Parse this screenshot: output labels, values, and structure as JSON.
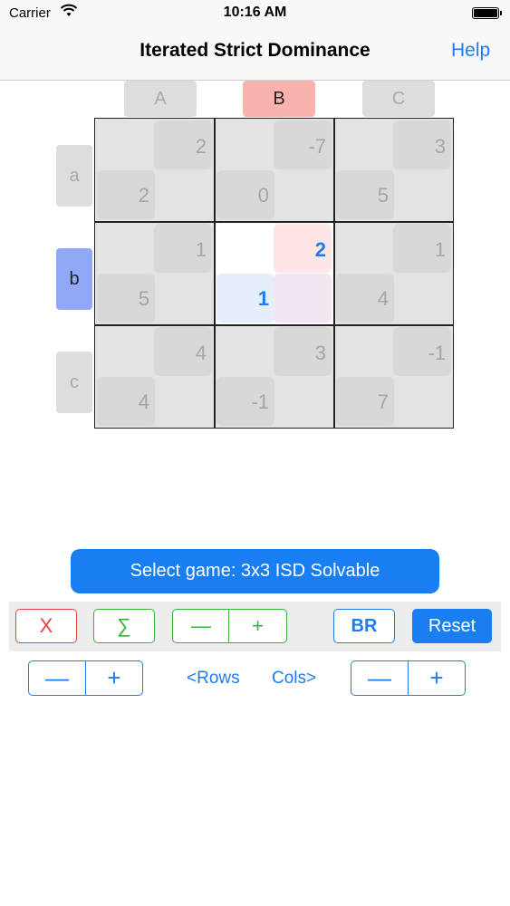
{
  "status": {
    "carrier": "Carrier",
    "time": "10:16 AM"
  },
  "nav": {
    "title": "Iterated Strict Dominance",
    "help": "Help"
  },
  "columns": [
    "A",
    "B",
    "C"
  ],
  "rows": [
    "a",
    "b",
    "c"
  ],
  "selected": {
    "row": "b",
    "column": "B"
  },
  "payoffs": {
    "aA": {
      "row": "2",
      "col": "2"
    },
    "aB": {
      "row": "0",
      "col": "-7"
    },
    "aC": {
      "row": "5",
      "col": "3"
    },
    "bA": {
      "row": "5",
      "col": "1"
    },
    "bB": {
      "row": "1",
      "col": "2"
    },
    "bC": {
      "row": "4",
      "col": "1"
    },
    "cA": {
      "row": "4",
      "col": "4"
    },
    "cB": {
      "row": "-1",
      "col": "3"
    },
    "cC": {
      "row": "7",
      "col": "-1"
    }
  },
  "select_game": "Select game: 3x3 ISD Solvable",
  "toolbar": {
    "x": "X",
    "sigma": "∑",
    "minus": "—",
    "plus": "+",
    "br": "BR",
    "reset": "Reset"
  },
  "dims": {
    "rows_label": "<Rows",
    "cols_label": "Cols>",
    "minus": "—",
    "plus": "+"
  },
  "colors": {
    "accent": "#1e7cf2",
    "row_player": "#8fa9f7",
    "col_player": "#f8b3ae",
    "remove": "#e84040",
    "sum": "#35b33c"
  }
}
